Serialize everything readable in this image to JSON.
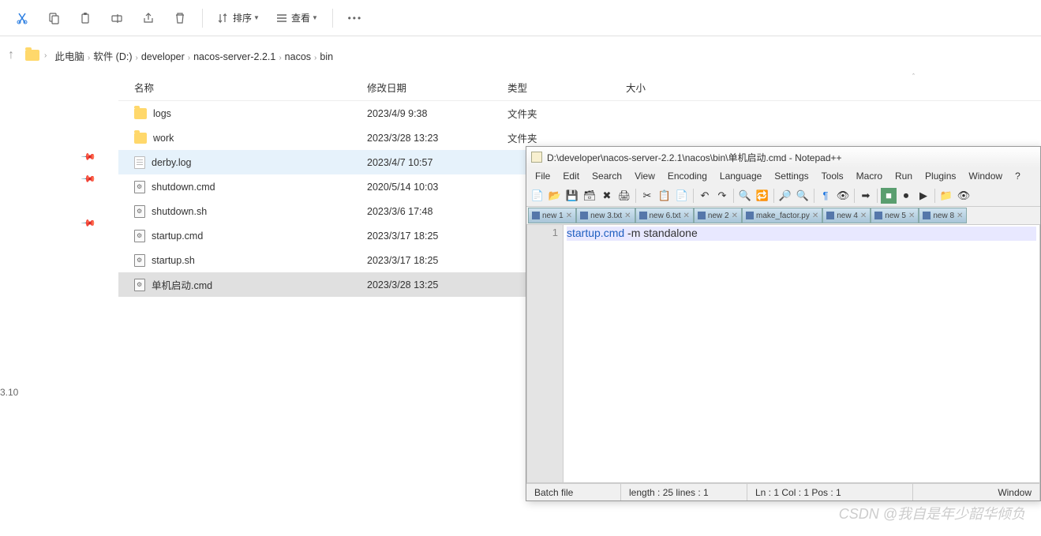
{
  "toolbar": {
    "sort_label": "排序",
    "view_label": "查看"
  },
  "breadcrumb": [
    "此电脑",
    "软件 (D:)",
    "developer",
    "nacos-server-2.2.1",
    "nacos",
    "bin"
  ],
  "columns": {
    "name": "名称",
    "date": "修改日期",
    "type": "类型",
    "size": "大小"
  },
  "files": [
    {
      "name": "logs",
      "date": "2023/4/9 9:38",
      "type": "文件夹",
      "icon": "folder",
      "state": ""
    },
    {
      "name": "work",
      "date": "2023/3/28 13:23",
      "type": "文件夹",
      "icon": "folder",
      "state": ""
    },
    {
      "name": "derby.log",
      "date": "2023/4/7 10:57",
      "type": "",
      "icon": "file",
      "state": "highlighted"
    },
    {
      "name": "shutdown.cmd",
      "date": "2020/5/14 10:03",
      "type": "",
      "icon": "cmd",
      "state": ""
    },
    {
      "name": "shutdown.sh",
      "date": "2023/3/6 17:48",
      "type": "",
      "icon": "cmd",
      "state": ""
    },
    {
      "name": "startup.cmd",
      "date": "2023/3/17 18:25",
      "type": "",
      "icon": "cmd",
      "state": ""
    },
    {
      "name": "startup.sh",
      "date": "2023/3/17 18:25",
      "type": "",
      "icon": "cmd",
      "state": ""
    },
    {
      "name": "单机启动.cmd",
      "date": "2023/3/28 13:25",
      "type": "",
      "icon": "cmd",
      "state": "selected"
    }
  ],
  "version": "3.10",
  "npp": {
    "title": "D:\\developer\\nacos-server-2.2.1\\nacos\\bin\\单机启动.cmd - Notepad++",
    "menu": [
      "File",
      "Edit",
      "Search",
      "View",
      "Encoding",
      "Language",
      "Settings",
      "Tools",
      "Macro",
      "Run",
      "Plugins",
      "Window",
      "?"
    ],
    "tabs": [
      "new 1",
      "new 3.txt",
      "new 6.txt",
      "new 2",
      "make_factor.py",
      "new 4",
      "new 5",
      "new 8"
    ],
    "line_no": "1",
    "code_cmd": "startup.cmd",
    "code_args": " -m standalone",
    "status": {
      "type": "Batch file",
      "length": "length : 25    lines : 1",
      "pos": "Ln : 1    Col : 1    Pos : 1",
      "enc": "Window"
    }
  },
  "watermark": "CSDN @我自是年少韶华倾负"
}
